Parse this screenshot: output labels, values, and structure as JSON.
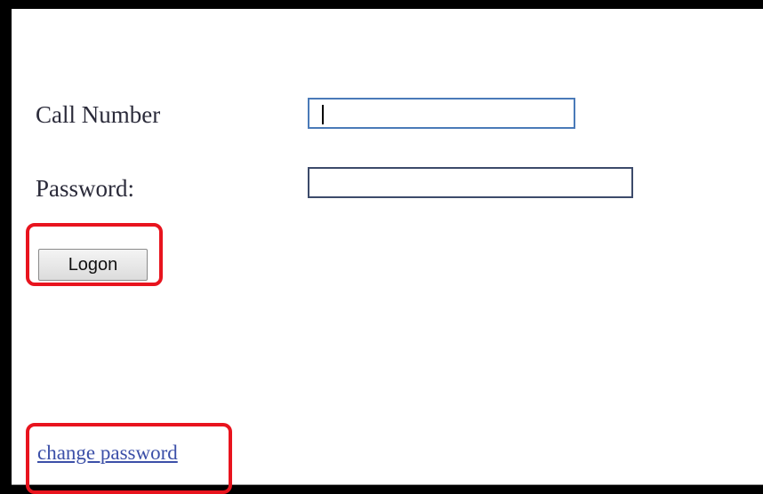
{
  "form": {
    "call_number_label": "Call Number",
    "call_number_value": "",
    "password_label": "Password:",
    "password_value": "",
    "logon_label": "Logon",
    "change_password_label": "change password"
  },
  "colors": {
    "highlight": "#e8141e",
    "link": "#3b4fa8",
    "focus_border": "#4a7ab8"
  }
}
